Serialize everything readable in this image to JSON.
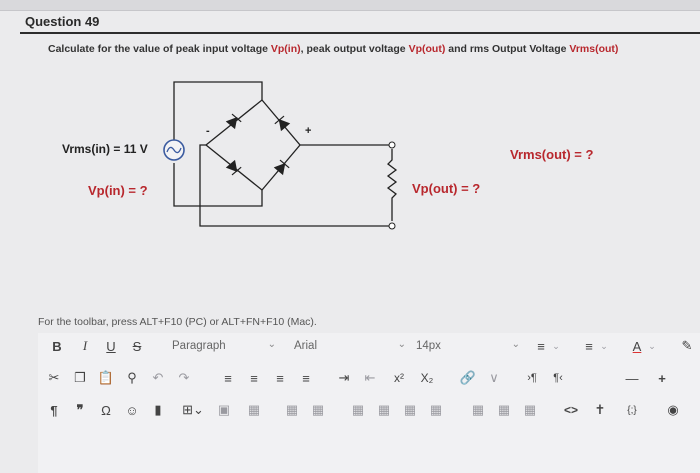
{
  "question": {
    "title": "Question 49",
    "text_prefix": "Calculate for the value of peak input voltage ",
    "vp_in_sym": "Vp(in)",
    "text_mid": ", peak output voltage ",
    "vp_out_sym": "Vp(out)",
    "text_mid2": " and rms Output Voltage ",
    "vrms_out_sym": "Vrms(out)"
  },
  "circuit": {
    "vrms_in_label": "Vrms(in) = 11 V",
    "vp_in_label": "Vp(in) = ?",
    "vp_out_label": "Vp(out) = ?",
    "vrms_out_label": "Vrms(out) = ?",
    "plus_sign": "+",
    "minus_sign": "-"
  },
  "editor": {
    "instruction": "For the toolbar, press ALT+F10 (PC) or ALT+FN+F10 (Mac).",
    "format_dropdown": "Paragraph",
    "font_dropdown": "Arial",
    "size_dropdown": "14px",
    "bold": "B",
    "italic": "I",
    "underline": "U",
    "strike": "S",
    "font_color": "A",
    "superscript": "x²",
    "subscript": "X₂",
    "pilcrow": "¶",
    "quote": "❞",
    "omega": "Ω",
    "code": "<>",
    "braces": "{;}",
    "minus": "—",
    "plus": "+"
  },
  "colors": {
    "accent_red": "#b8272d",
    "background": "#ebebed",
    "circuit_blue": "#3b5ba0"
  }
}
